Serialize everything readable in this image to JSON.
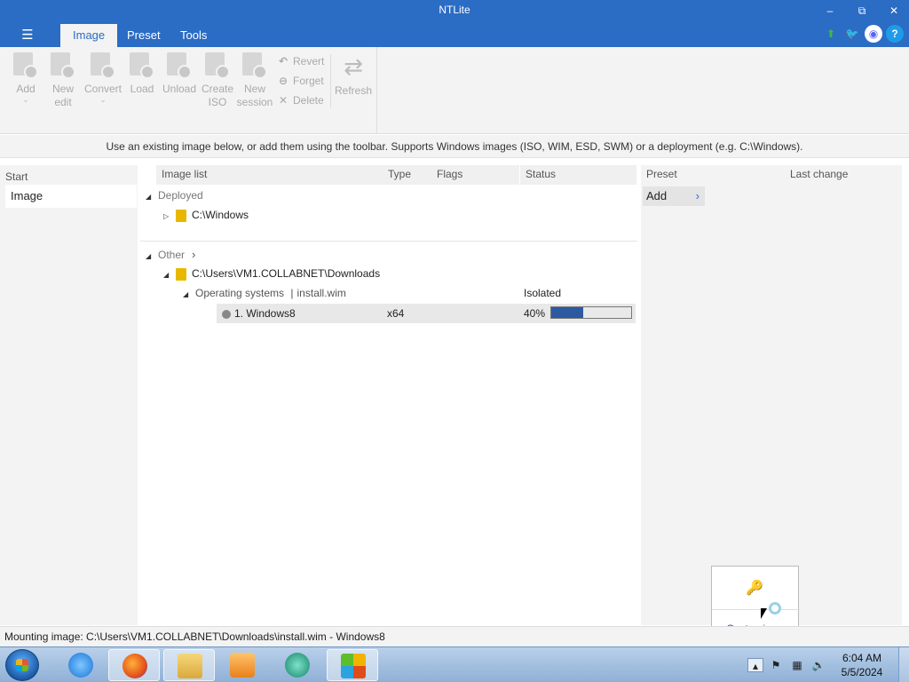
{
  "window": {
    "title": "NTLite",
    "controls": {
      "minimize": "–",
      "restore": "⧉",
      "close": "✕"
    }
  },
  "tabs": [
    {
      "label": "Image",
      "active": true
    },
    {
      "label": "Preset",
      "active": false
    },
    {
      "label": "Tools",
      "active": false
    }
  ],
  "menu_icon": "☰",
  "top_icons": [
    "update-arrow-icon",
    "twitter-icon",
    "discord-icon",
    "help-icon"
  ],
  "ribbon": {
    "add": "Add",
    "new_edit_1": "New",
    "new_edit_2": "edit",
    "convert": "Convert",
    "load": "Load",
    "unload": "Unload",
    "create_iso_1": "Create",
    "create_iso_2": "ISO",
    "new_session_1": "New",
    "new_session_2": "session",
    "revert": "Revert",
    "forget": "Forget",
    "delete": "Delete",
    "refresh": "Refresh"
  },
  "hint": "Use an existing image below, or add them using the toolbar. Supports Windows images (ISO, WIM, ESD, SWM) or a deployment (e.g. C:\\Windows).",
  "leftnav": {
    "start": "Start",
    "image": "Image"
  },
  "columns": {
    "image_list": "Image list",
    "type": "Type",
    "flags": "Flags",
    "status": "Status"
  },
  "deployed": {
    "label": "Deployed",
    "path": "C:\\Windows"
  },
  "other": {
    "label": "Other",
    "path": "C:\\Users\\VM1.COLLABNET\\Downloads",
    "os_label": "Operating systems",
    "os_file": "install.wim",
    "os_sep": "|",
    "status": "Isolated",
    "image": {
      "name": "1. Windows8",
      "type": "x64",
      "progress_text": "40%",
      "progress": 0.4
    }
  },
  "preset": {
    "col_preset": "Preset",
    "col_last_change": "Last change",
    "add": "Add"
  },
  "popup": {
    "label": "Customize..."
  },
  "statusbar": "Mounting image: C:\\Users\\VM1.COLLABNET\\Downloads\\install.wim - Windows8",
  "taskbar": {
    "apps": [
      "internet-explorer-icon",
      "firefox-icon",
      "file-explorer-icon",
      "media-player-icon",
      "app-icon",
      "ntlite-icon"
    ],
    "clock_time": "6:04 AM",
    "clock_date": "5/5/2024"
  },
  "colors": {
    "accent": "#2b6cc4",
    "progress": "#2c5aa0"
  }
}
